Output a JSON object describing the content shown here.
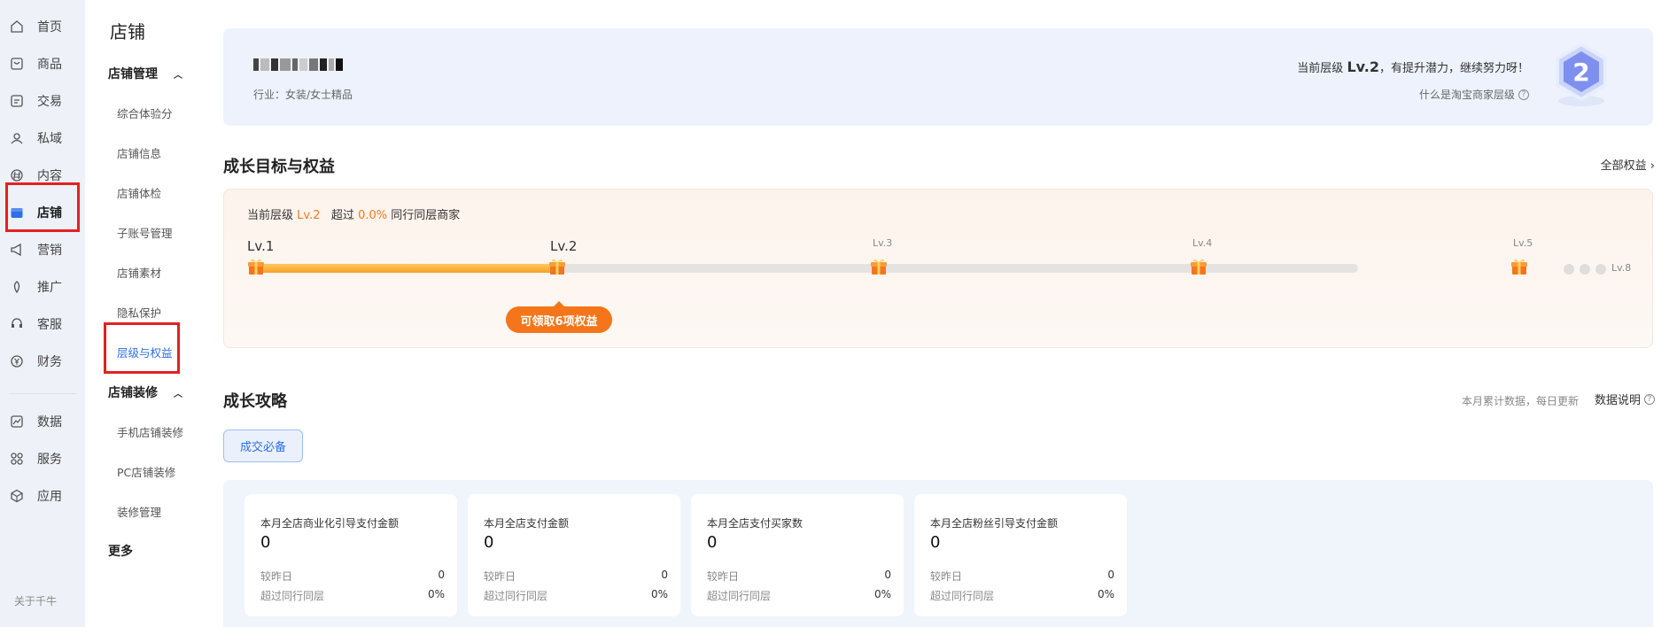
{
  "rail": {
    "items": [
      {
        "label": "首页",
        "icon": "home-icon"
      },
      {
        "label": "商品",
        "icon": "goods-icon"
      },
      {
        "label": "交易",
        "icon": "trade-icon"
      },
      {
        "label": "私域",
        "icon": "private-domain-icon"
      },
      {
        "label": "内容",
        "icon": "content-icon"
      },
      {
        "label": "店铺",
        "icon": "store-icon"
      },
      {
        "label": "营销",
        "icon": "marketing-icon"
      },
      {
        "label": "推广",
        "icon": "promotion-icon"
      },
      {
        "label": "客服",
        "icon": "customer-service-icon"
      },
      {
        "label": "财务",
        "icon": "finance-icon"
      },
      {
        "label": "数据",
        "icon": "data-icon"
      },
      {
        "label": "服务",
        "icon": "service-icon"
      },
      {
        "label": "应用",
        "icon": "apps-icon"
      }
    ],
    "footer": "关于千牛",
    "active_color": "#2f6fe4"
  },
  "subnav": {
    "title": "店铺",
    "group1": "店铺管理",
    "group1_items": [
      "综合体验分",
      "店铺信息",
      "店铺体检",
      "子账号管理",
      "店铺素材",
      "隐私保护",
      "层级与权益"
    ],
    "group2": "店铺装修",
    "group2_items": [
      "手机店铺装修",
      "PC店铺装修",
      "装修管理"
    ],
    "more": "更多"
  },
  "hero": {
    "industry": "行业：女装/女士精品",
    "level_prefix": "当前层级",
    "level": "Lv.2",
    "level_suffix": "，有提升潜力，继续努力呀！",
    "help": "什么是淘宝商家层级",
    "badge_number": "2"
  },
  "growth": {
    "title": "成长目标与权益",
    "all_benefits": "全部权益",
    "current_prefix": "当前层级",
    "current_level": "Lv.2",
    "exceed_prefix": "超过",
    "exceed_value": "0.0%",
    "exceed_suffix": "同行同层商家",
    "levels": [
      "Lv.1",
      "Lv.2",
      "Lv.3",
      "Lv.4",
      "Lv.5"
    ],
    "last_level": "Lv.8",
    "benefit_pill": "可领取6项权益",
    "accent": "#f5761a"
  },
  "strategy": {
    "title": "成长攻略",
    "meta": "本月累计数据，每日更新",
    "data_explain": "数据说明",
    "tab": "成交必备"
  },
  "metrics": [
    {
      "title": "本月全店商业化引导支付金额",
      "value": "0",
      "row1_label": "较昨日",
      "row1_value": "0",
      "row2_label": "超过同行同层",
      "row2_value": "0%"
    },
    {
      "title": "本月全店支付金额",
      "value": "0",
      "row1_label": "较昨日",
      "row1_value": "0",
      "row2_label": "超过同行同层",
      "row2_value": "0%"
    },
    {
      "title": "本月全店支付买家数",
      "value": "0",
      "row1_label": "较昨日",
      "row1_value": "0",
      "row2_label": "超过同行同层",
      "row2_value": "0%"
    },
    {
      "title": "本月全店粉丝引导支付金额",
      "value": "0",
      "row1_label": "较昨日",
      "row1_value": "0",
      "row2_label": "超过同行同层",
      "row2_value": "0%"
    }
  ]
}
